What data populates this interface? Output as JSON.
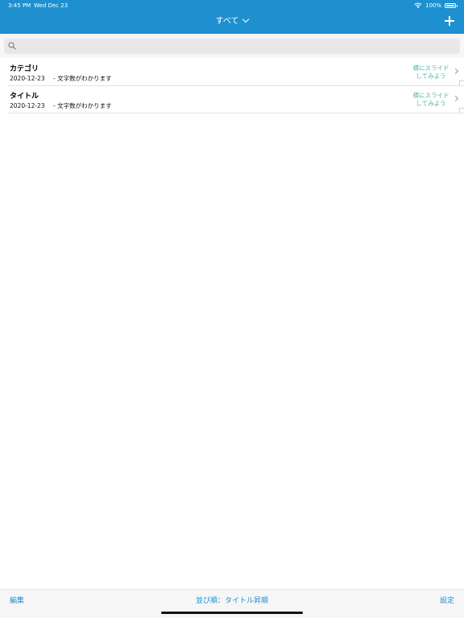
{
  "status_bar": {
    "time": "3:45 PM",
    "date": "Wed Dec 23",
    "battery": "100%",
    "icons": [
      "wifi-icon",
      "battery-icon"
    ]
  },
  "nav": {
    "title": "すべて",
    "title_icon": "chevron-down-icon",
    "add_icon": "plus-icon"
  },
  "search": {
    "value": "",
    "placeholder": "",
    "icon": "search-icon"
  },
  "list": {
    "items": [
      {
        "title": "カテゴリ",
        "date": "2020-12-23",
        "meta": "- 文字数がわかります",
        "hint_line1": "横にスライド",
        "hint_line2": "してみよう"
      },
      {
        "title": "タイトル",
        "date": "2020-12-23",
        "meta": "- 文字数がわかります",
        "hint_line1": "横にスライド",
        "hint_line2": "してみよう"
      }
    ]
  },
  "toolbar": {
    "edit_label": "編集",
    "sort_label": "並び順：タイトル昇順",
    "settings_label": "設定"
  },
  "colors": {
    "header_bg": "#1e90d0",
    "accent": "#1e90d0",
    "hint_text": "#4fb3a3"
  }
}
